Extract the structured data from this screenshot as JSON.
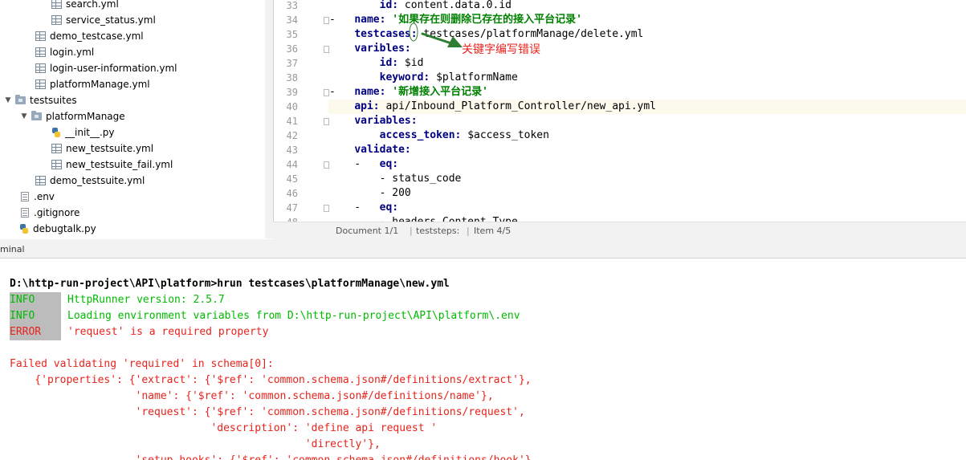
{
  "project_tree": {
    "items": [
      {
        "label": "search.yml",
        "icon": "yml-file-icon"
      },
      {
        "label": "service_status.yml",
        "icon": "yml-file-icon"
      },
      {
        "label": "demo_testcase.yml",
        "icon": "yml-file-icon"
      },
      {
        "label": "login.yml",
        "icon": "yml-file-icon"
      },
      {
        "label": "login-user-information.yml",
        "icon": "yml-file-icon"
      },
      {
        "label": "platformManage.yml",
        "icon": "yml-file-icon"
      },
      {
        "label": "testsuites",
        "icon": "folder-icon"
      },
      {
        "label": "platformManage",
        "icon": "folder-icon"
      },
      {
        "label": "__init__.py",
        "icon": "python-file-icon"
      },
      {
        "label": "new_testsuite.yml",
        "icon": "yml-file-icon"
      },
      {
        "label": "new_testsuite_fail.yml",
        "icon": "yml-file-icon"
      },
      {
        "label": "demo_testsuite.yml",
        "icon": "yml-file-icon"
      },
      {
        "label": ".env",
        "icon": "text-file-icon"
      },
      {
        "label": ".gitignore",
        "icon": "text-file-icon"
      },
      {
        "label": "debugtalk.py",
        "icon": "python-file-icon"
      }
    ]
  },
  "editor": {
    "lines": [
      {
        "num": "33",
        "tokens": [
          {
            "t": "        ",
            "c": ""
          },
          {
            "t": "id:",
            "c": "k"
          },
          {
            "t": " content.data.0.id",
            "c": ""
          }
        ]
      },
      {
        "num": "34",
        "tokens": [
          {
            "t": "-   ",
            "c": ""
          },
          {
            "t": "name:",
            "c": "k"
          },
          {
            "t": " ",
            "c": ""
          },
          {
            "t": "'如果存在则删除已存在的接入平台记录'",
            "c": "s"
          }
        ]
      },
      {
        "num": "35",
        "tokens": [
          {
            "t": "    ",
            "c": ""
          },
          {
            "t": "testcases:",
            "c": "k"
          },
          {
            "t": " testcases/platformManage/delete.yml",
            "c": ""
          }
        ]
      },
      {
        "num": "36",
        "tokens": [
          {
            "t": "    ",
            "c": ""
          },
          {
            "t": "varibles:",
            "c": "k"
          }
        ]
      },
      {
        "num": "37",
        "tokens": [
          {
            "t": "        ",
            "c": ""
          },
          {
            "t": "id:",
            "c": "k"
          },
          {
            "t": " $id",
            "c": ""
          }
        ]
      },
      {
        "num": "38",
        "tokens": [
          {
            "t": "        ",
            "c": ""
          },
          {
            "t": "keyword:",
            "c": "k"
          },
          {
            "t": " $platformName",
            "c": ""
          }
        ]
      },
      {
        "num": "39",
        "tokens": [
          {
            "t": "-   ",
            "c": ""
          },
          {
            "t": "name:",
            "c": "k"
          },
          {
            "t": " ",
            "c": ""
          },
          {
            "t": "'新增接入平台记录'",
            "c": "s"
          }
        ]
      },
      {
        "num": "40",
        "tokens": [
          {
            "t": "    ",
            "c": ""
          },
          {
            "t": "api:",
            "c": "k"
          },
          {
            "t": " api/Inbound_Platform_Controller/new_api.yml",
            "c": ""
          }
        ]
      },
      {
        "num": "41",
        "tokens": [
          {
            "t": "    ",
            "c": ""
          },
          {
            "t": "variables:",
            "c": "k"
          }
        ]
      },
      {
        "num": "42",
        "tokens": [
          {
            "t": "        ",
            "c": ""
          },
          {
            "t": "access_token:",
            "c": "k"
          },
          {
            "t": " $access_token",
            "c": ""
          }
        ]
      },
      {
        "num": "43",
        "tokens": [
          {
            "t": "    ",
            "c": ""
          },
          {
            "t": "validate:",
            "c": "k"
          }
        ]
      },
      {
        "num": "44",
        "tokens": [
          {
            "t": "    -   ",
            "c": ""
          },
          {
            "t": "eq:",
            "c": "k"
          }
        ]
      },
      {
        "num": "45",
        "tokens": [
          {
            "t": "        - status_code",
            "c": ""
          }
        ]
      },
      {
        "num": "46",
        "tokens": [
          {
            "t": "        - 200",
            "c": ""
          }
        ]
      },
      {
        "num": "47",
        "tokens": [
          {
            "t": "    -   ",
            "c": ""
          },
          {
            "t": "eq:",
            "c": "k"
          }
        ]
      },
      {
        "num": "48",
        "tokens": [
          {
            "t": "        - headers.Content-Type",
            "c": ""
          }
        ]
      }
    ],
    "current_line": "40",
    "annotation": "关键字编写错误"
  },
  "statusbar": {
    "document": "Document 1/1",
    "path": "teststeps:",
    "item": "Item 4/5"
  },
  "terminal": {
    "tab_label": "minal",
    "command": "D:\\http-run-project\\API\\platform>hrun testcases\\platformManage\\new.yml",
    "logs": [
      {
        "level": "INFO",
        "message": "HttpRunner version: 2.5.7",
        "color": "green"
      },
      {
        "level": "INFO",
        "message": "Loading environment variables from D:\\http-run-project\\API\\platform\\.env",
        "color": "green"
      },
      {
        "level": "ERROR",
        "message": "'request' is a required property",
        "color": "red"
      }
    ],
    "error_lines": [
      "Failed validating 'required' in schema[0]:",
      "    {'properties': {'extract': {'$ref': 'common.schema.json#/definitions/extract'},",
      "                    'name': {'$ref': 'common.schema.json#/definitions/name'},",
      "                    'request': {'$ref': 'common.schema.json#/definitions/request',",
      "                                'description': 'define api request '",
      "                                               'directly'},",
      "                    'setup_hooks': {'$ref': 'common.schema.json#/definitions/hook'},"
    ]
  },
  "colors": {
    "key": "#000080",
    "string": "#008000",
    "info": "#00bb00",
    "error": "#e8231c",
    "annotation": "#e8231c",
    "arrow": "#2e7d32"
  }
}
